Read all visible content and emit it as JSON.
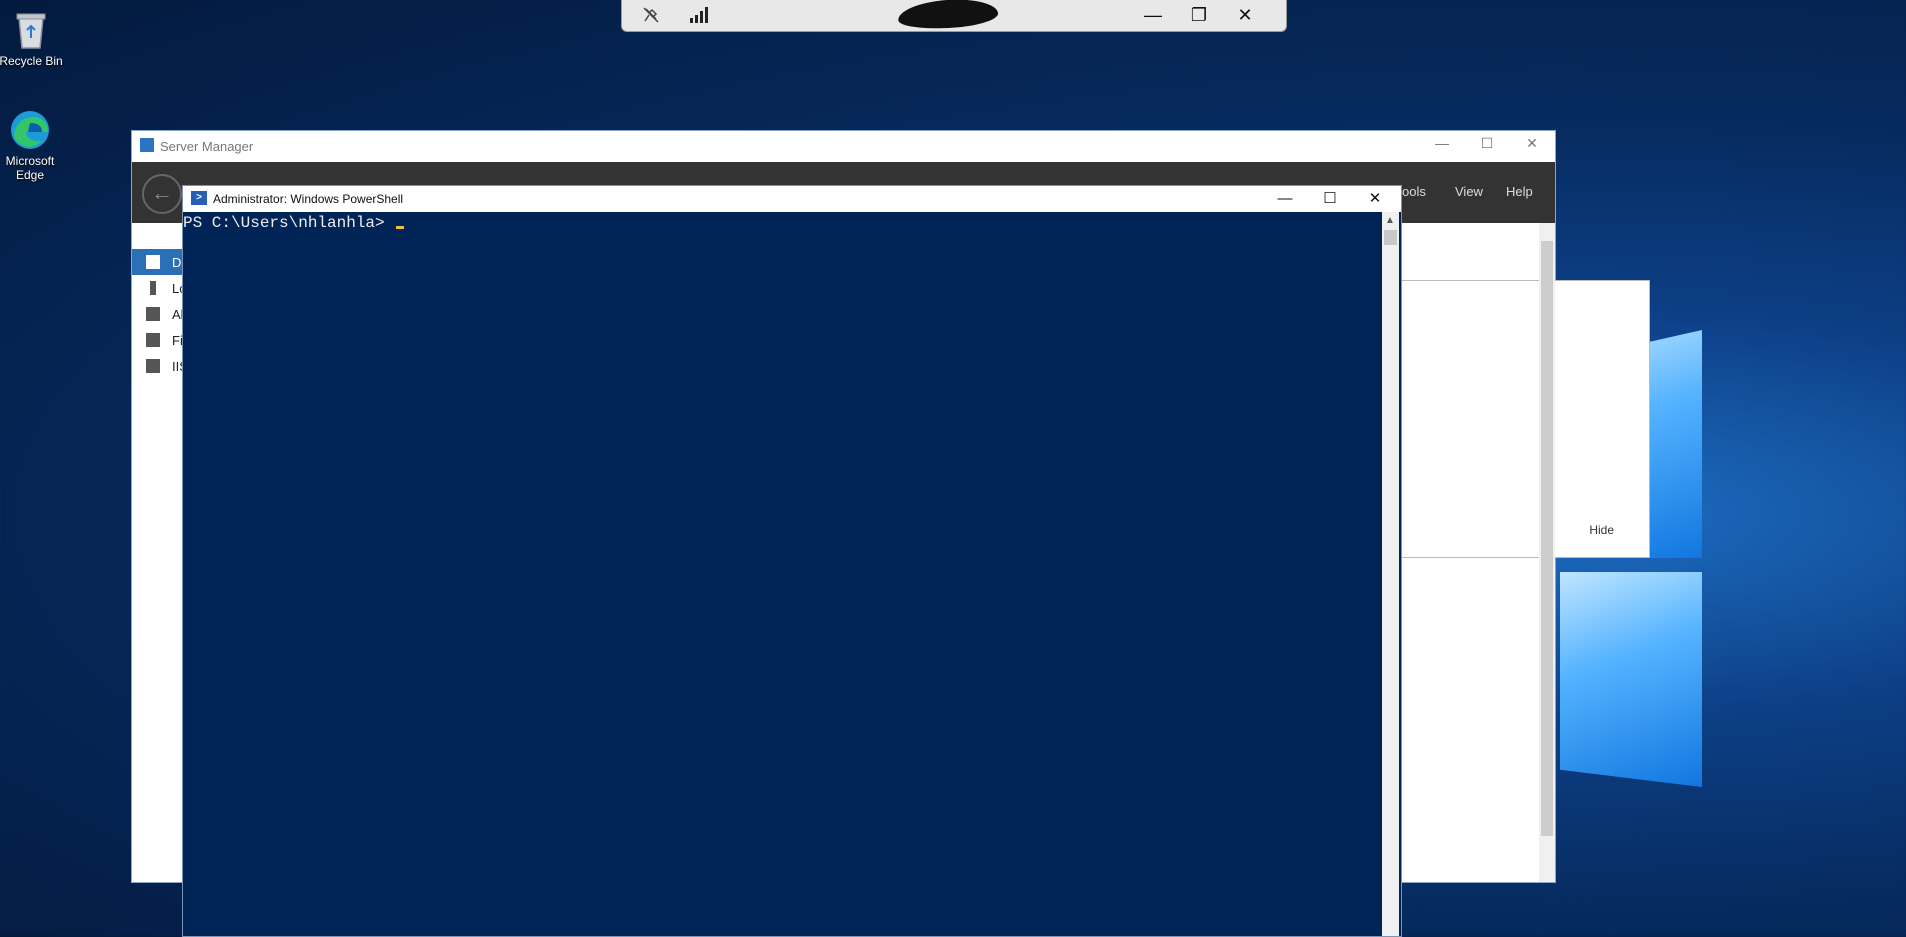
{
  "desktop": {
    "icons": [
      {
        "label": "Recycle Bin"
      },
      {
        "label": "Microsoft Edge"
      }
    ]
  },
  "remote_toolbar": {
    "pin_icon": "unpin-icon",
    "signal_icon": "signal-bars-icon",
    "minimize": "—",
    "restore": "❐",
    "close": "✕"
  },
  "server_manager": {
    "title": "Server Manager",
    "menu": {
      "tools": "ools",
      "view": "View",
      "help": "Help"
    },
    "nav": [
      {
        "label": "Da",
        "active": true
      },
      {
        "label": "Lo",
        "active": false
      },
      {
        "label": "Al",
        "active": false
      },
      {
        "label": "Fi",
        "active": false
      },
      {
        "label": "IIS",
        "active": false
      }
    ],
    "panel": {
      "hide_label": "Hide"
    },
    "window_buttons": {
      "minimize": "—",
      "maximize": "☐",
      "close": "✕"
    }
  },
  "powershell": {
    "title": "Administrator: Windows PowerShell",
    "prompt": "PS C:\\Users\\nhlanhla> ",
    "window_buttons": {
      "minimize": "—",
      "maximize": "☐",
      "close": "✕"
    },
    "colors": {
      "background": "#012456",
      "text": "#eeedf0",
      "cursor": "#f5c040"
    }
  }
}
